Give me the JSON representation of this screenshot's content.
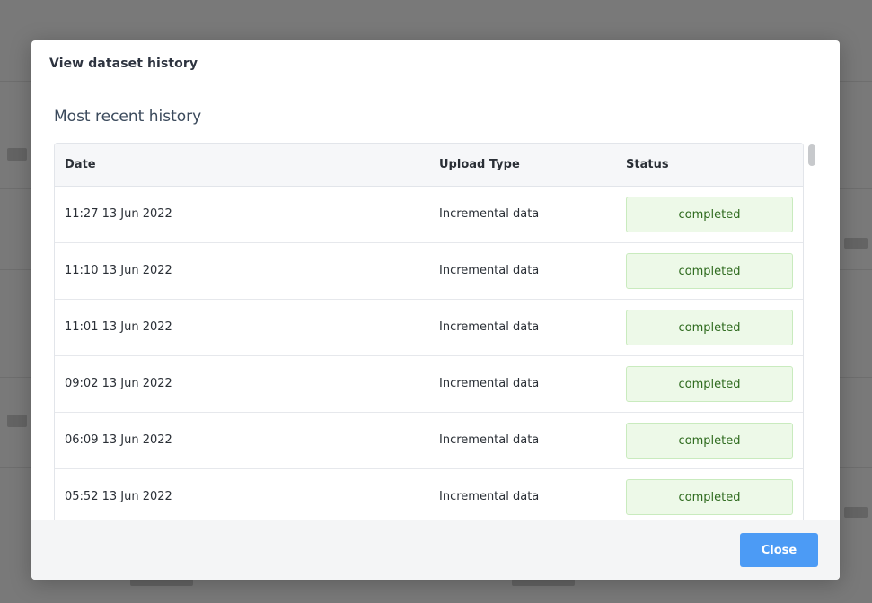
{
  "modal": {
    "title": "View dataset history",
    "section_title": "Most recent history",
    "close_label": "Close"
  },
  "table": {
    "headers": {
      "date": "Date",
      "upload_type": "Upload Type",
      "status": "Status"
    },
    "rows": [
      {
        "date": "11:27 13 Jun 2022",
        "upload_type": "Incremental data",
        "status": "completed"
      },
      {
        "date": "11:10 13 Jun 2022",
        "upload_type": "Incremental data",
        "status": "completed"
      },
      {
        "date": "11:01 13 Jun 2022",
        "upload_type": "Incremental data",
        "status": "completed"
      },
      {
        "date": "09:02 13 Jun 2022",
        "upload_type": "Incremental data",
        "status": "completed"
      },
      {
        "date": "06:09 13 Jun 2022",
        "upload_type": "Incremental data",
        "status": "completed"
      },
      {
        "date": "05:52 13 Jun 2022",
        "upload_type": "Incremental data",
        "status": "completed"
      }
    ]
  },
  "colors": {
    "primary_button": "#4c9bf5",
    "status_completed_bg": "#edf9e8",
    "status_completed_text": "#2f6b1f"
  }
}
